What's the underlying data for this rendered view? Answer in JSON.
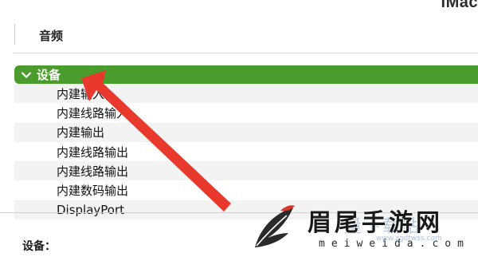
{
  "window": {
    "title": "iMac"
  },
  "section": {
    "header": "音频"
  },
  "tree": {
    "group_label": "设备",
    "items": [
      {
        "label": "内建输入"
      },
      {
        "label": "内建线路输入"
      },
      {
        "label": "内建输出"
      },
      {
        "label": "内建线路输出"
      },
      {
        "label": "内建线路输出"
      },
      {
        "label": "内建数码输出"
      },
      {
        "label": "DisplayPort"
      }
    ]
  },
  "detail": {
    "label": "设备："
  },
  "watermark": {
    "title": "眉尾手游网",
    "url": "meiweida.com",
    "faint_text": "量下载站",
    "faint_url": "www.zgdtwss.com"
  },
  "colors": {
    "selection_green": "#4a9d2c",
    "arrow_red": "#e8392c",
    "row_stripe": "#f3f3f3"
  },
  "icons": {
    "group_toggle": "chevron-down-icon",
    "annotation": "red-arrow-icon",
    "watermark_logo": "feather-logo-icon"
  }
}
